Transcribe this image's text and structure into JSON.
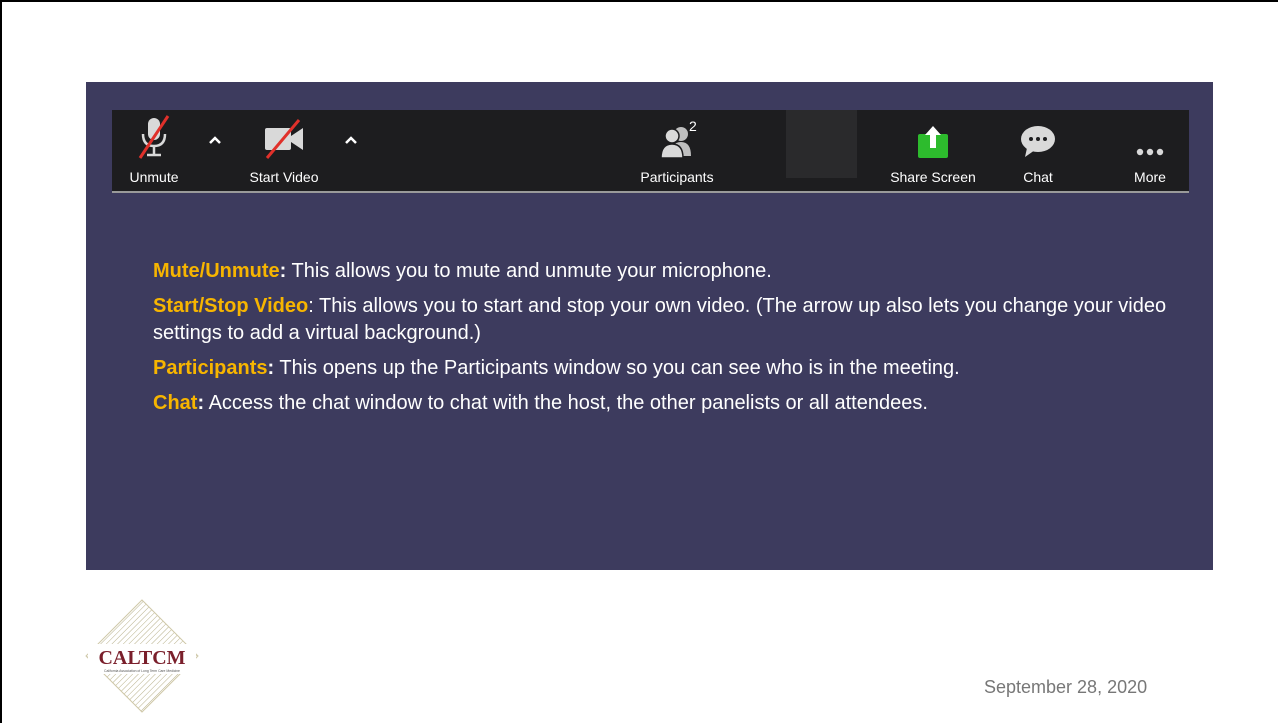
{
  "toolbar": {
    "unmute_label": "Unmute",
    "start_video_label": "Start Video",
    "participants_label": "Participants",
    "participants_count": "2",
    "share_screen_label": "Share Screen",
    "chat_label": "Chat",
    "more_label": "More",
    "share_color": "#2dbb2d"
  },
  "items": [
    {
      "title": "Mute/Unmute",
      "colon": ":",
      "text": " This allows you to mute and unmute your microphone."
    },
    {
      "title": "Start/Stop Video",
      "colon": ":",
      "text": " This allows you to start and stop your own video. (The arrow up also lets you change your video settings to add a virtual background.)"
    },
    {
      "title": "Participants",
      "colon": ":",
      "text": " This opens up the Participants window so you can see who is in the meeting."
    },
    {
      "title": "Chat",
      "colon": ":",
      "text": " Access the chat window to chat with the host, the other panelists or all attendees."
    }
  ],
  "logo_text": "CALTCM",
  "logo_subtext": "California Association of Long Term Care Medicine",
  "footer_date": "September 28, 2020"
}
